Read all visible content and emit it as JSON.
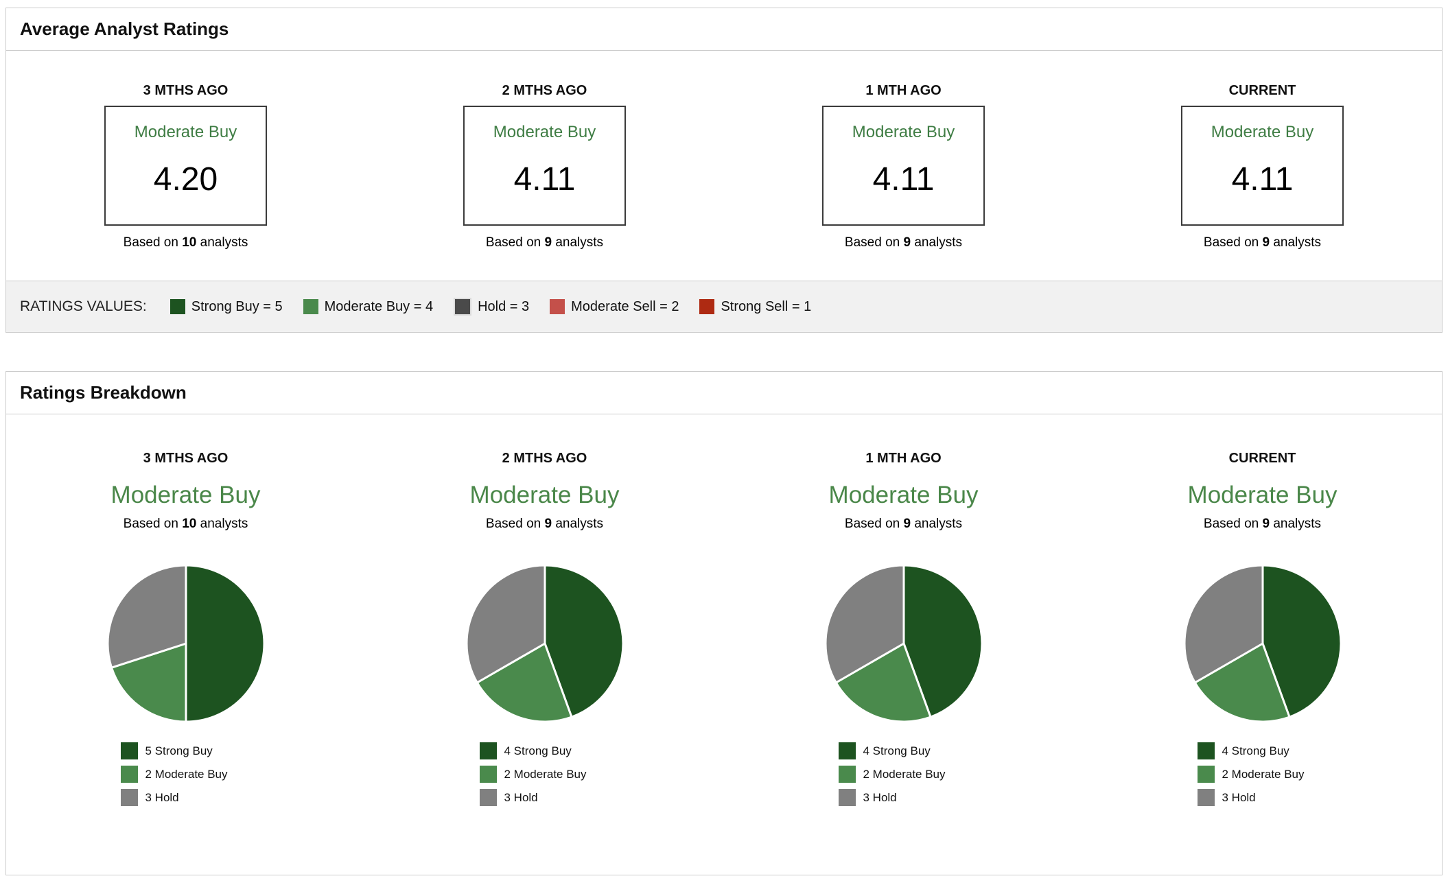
{
  "ratings": {
    "title": "Average Analyst Ratings",
    "columns": [
      {
        "period": "3 MTHS AGO",
        "rating": "Moderate Buy",
        "score": "4.20",
        "based_prefix": "Based on",
        "count": "10",
        "based_suffix": "analysts"
      },
      {
        "period": "2 MTHS AGO",
        "rating": "Moderate Buy",
        "score": "4.11",
        "based_prefix": "Based on",
        "count": "9",
        "based_suffix": "analysts"
      },
      {
        "period": "1 MTH AGO",
        "rating": "Moderate Buy",
        "score": "4.11",
        "based_prefix": "Based on",
        "count": "9",
        "based_suffix": "analysts"
      },
      {
        "period": "CURRENT",
        "rating": "Moderate Buy",
        "score": "4.11",
        "based_prefix": "Based on",
        "count": "9",
        "based_suffix": "analysts"
      }
    ],
    "values_legend": {
      "label": "RATINGS VALUES:",
      "items": [
        {
          "label": "Strong Buy = 5",
          "color": "#1d5320"
        },
        {
          "label": "Moderate Buy = 4",
          "color": "#4a8a4c"
        },
        {
          "label": "Hold = 3",
          "color": "#4a4a4a",
          "border": "#dcdcdc"
        },
        {
          "label": "Moderate Sell = 2",
          "color": "#c4504a"
        },
        {
          "label": "Strong Sell = 1",
          "color": "#ae2a12"
        }
      ]
    },
    "colors": {
      "rating_text": "#3f7d44",
      "box_border": "#3b3b3b"
    }
  },
  "breakdown": {
    "title": "Ratings Breakdown",
    "columns": [
      {
        "period": "3 MTHS AGO",
        "rating": "Moderate Buy",
        "based_prefix": "Based on",
        "count": "10",
        "based_suffix": "analysts",
        "slices": [
          {
            "label": "5 Strong Buy",
            "value": 5,
            "color": "#1d5320"
          },
          {
            "label": "2 Moderate Buy",
            "value": 2,
            "color": "#4a8a4c"
          },
          {
            "label": "3 Hold",
            "value": 3,
            "color": "#808080"
          }
        ]
      },
      {
        "period": "2 MTHS AGO",
        "rating": "Moderate Buy",
        "based_prefix": "Based on",
        "count": "9",
        "based_suffix": "analysts",
        "slices": [
          {
            "label": "4 Strong Buy",
            "value": 4,
            "color": "#1d5320"
          },
          {
            "label": "2 Moderate Buy",
            "value": 2,
            "color": "#4a8a4c"
          },
          {
            "label": "3 Hold",
            "value": 3,
            "color": "#808080"
          }
        ]
      },
      {
        "period": "1 MTH AGO",
        "rating": "Moderate Buy",
        "based_prefix": "Based on",
        "count": "9",
        "based_suffix": "analysts",
        "slices": [
          {
            "label": "4 Strong Buy",
            "value": 4,
            "color": "#1d5320"
          },
          {
            "label": "2 Moderate Buy",
            "value": 2,
            "color": "#4a8a4c"
          },
          {
            "label": "3 Hold",
            "value": 3,
            "color": "#808080"
          }
        ]
      },
      {
        "period": "CURRENT",
        "rating": "Moderate Buy",
        "based_prefix": "Based on",
        "count": "9",
        "based_suffix": "analysts",
        "slices": [
          {
            "label": "4 Strong Buy",
            "value": 4,
            "color": "#1d5320"
          },
          {
            "label": "2 Moderate Buy",
            "value": 2,
            "color": "#4a8a4c"
          },
          {
            "label": "3 Hold",
            "value": 3,
            "color": "#808080"
          }
        ]
      }
    ],
    "colors": {
      "rating_text": "#4a8749"
    }
  },
  "chart_data": [
    {
      "type": "pie",
      "title": "3 MTHS AGO",
      "subtitle": "Moderate Buy",
      "based_on_analysts": 10,
      "labels": [
        "5 Strong Buy",
        "2 Moderate Buy",
        "3 Hold"
      ],
      "values": [
        5,
        2,
        3
      ],
      "colors": [
        "#1d5320",
        "#4a8a4c",
        "#808080"
      ],
      "legend_position": "bottom",
      "start_angle_deg": -90,
      "direction": "clockwise"
    },
    {
      "type": "pie",
      "title": "2 MTHS AGO",
      "subtitle": "Moderate Buy",
      "based_on_analysts": 9,
      "labels": [
        "4 Strong Buy",
        "2 Moderate Buy",
        "3 Hold"
      ],
      "values": [
        4,
        2,
        3
      ],
      "colors": [
        "#1d5320",
        "#4a8a4c",
        "#808080"
      ],
      "legend_position": "bottom",
      "start_angle_deg": -90,
      "direction": "clockwise"
    },
    {
      "type": "pie",
      "title": "1 MTH AGO",
      "subtitle": "Moderate Buy",
      "based_on_analysts": 9,
      "labels": [
        "4 Strong Buy",
        "2 Moderate Buy",
        "3 Hold"
      ],
      "values": [
        4,
        2,
        3
      ],
      "colors": [
        "#1d5320",
        "#4a8a4c",
        "#808080"
      ],
      "legend_position": "bottom",
      "start_angle_deg": -90,
      "direction": "clockwise"
    },
    {
      "type": "pie",
      "title": "CURRENT",
      "subtitle": "Moderate Buy",
      "based_on_analysts": 9,
      "labels": [
        "4 Strong Buy",
        "2 Moderate Buy",
        "3 Hold"
      ],
      "values": [
        4,
        2,
        3
      ],
      "colors": [
        "#1d5320",
        "#4a8a4c",
        "#808080"
      ],
      "legend_position": "bottom",
      "start_angle_deg": -90,
      "direction": "clockwise"
    },
    {
      "type": "table",
      "title": "Average Analyst Ratings",
      "columns": [
        "period",
        "rating",
        "average_rating",
        "analysts"
      ],
      "rows": [
        [
          "3 MTHS AGO",
          "Moderate Buy",
          4.2,
          10
        ],
        [
          "2 MTHS AGO",
          "Moderate Buy",
          4.11,
          9
        ],
        [
          "1 MTH AGO",
          "Moderate Buy",
          4.11,
          9
        ],
        [
          "CURRENT",
          "Moderate Buy",
          4.11,
          9
        ]
      ],
      "ratings_values_key": {
        "Strong Buy": 5,
        "Moderate Buy": 4,
        "Hold": 3,
        "Moderate Sell": 2,
        "Strong Sell": 1
      }
    }
  ]
}
